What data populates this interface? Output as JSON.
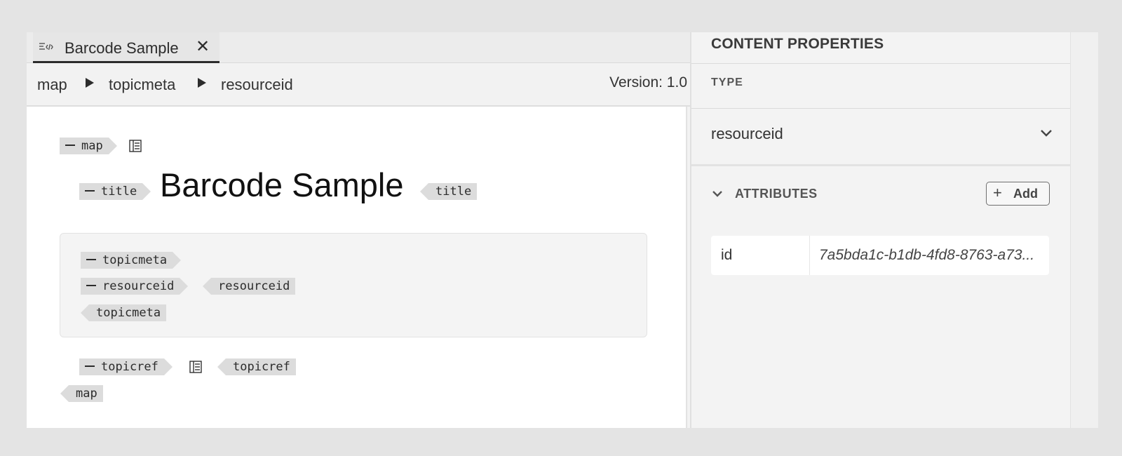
{
  "tab": {
    "title": "Barcode Sample",
    "icon": "source-view-icon",
    "close_glyph": "✕"
  },
  "breadcrumb": {
    "items": [
      "map",
      "topicmeta",
      "resourceid"
    ],
    "version": "Version: 1.0"
  },
  "document": {
    "tags": {
      "map_open": "map",
      "title_open": "title",
      "title_close": "title",
      "topicmeta_open": "topicmeta",
      "resourceid_open": "resourceid",
      "resourceid_close": "resourceid",
      "topicmeta_close": "topicmeta",
      "topicref_open": "topicref",
      "topicref_close": "topicref",
      "map_close": "map"
    },
    "title_text": "Barcode Sample"
  },
  "properties": {
    "header": "CONTENT PROPERTIES",
    "type_label": "TYPE",
    "type_value": "resourceid",
    "attributes_label": "ATTRIBUTES",
    "add_label": "Add",
    "attributes": [
      {
        "name": "id",
        "value": "7a5bda1c-b1db-4fd8-8763-a73..."
      }
    ]
  }
}
